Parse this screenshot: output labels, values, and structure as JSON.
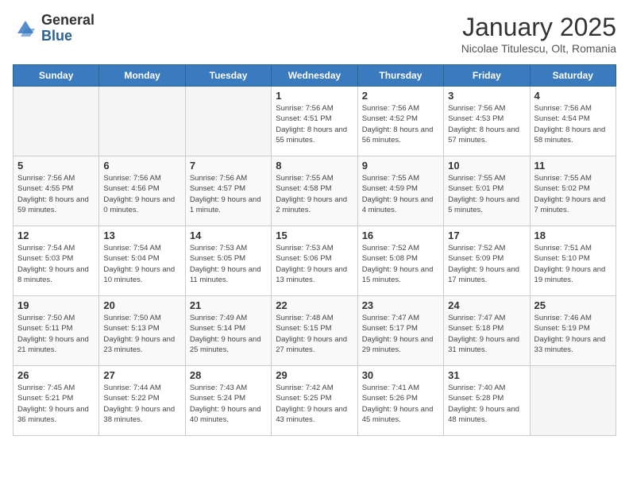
{
  "header": {
    "logo_general": "General",
    "logo_blue": "Blue",
    "title": "January 2025",
    "subtitle": "Nicolae Titulescu, Olt, Romania"
  },
  "days_of_week": [
    "Sunday",
    "Monday",
    "Tuesday",
    "Wednesday",
    "Thursday",
    "Friday",
    "Saturday"
  ],
  "weeks": [
    [
      {
        "day": "",
        "empty": true
      },
      {
        "day": "",
        "empty": true
      },
      {
        "day": "",
        "empty": true
      },
      {
        "day": "1",
        "sunrise": "Sunrise: 7:56 AM",
        "sunset": "Sunset: 4:51 PM",
        "daylight": "Daylight: 8 hours and 55 minutes."
      },
      {
        "day": "2",
        "sunrise": "Sunrise: 7:56 AM",
        "sunset": "Sunset: 4:52 PM",
        "daylight": "Daylight: 8 hours and 56 minutes."
      },
      {
        "day": "3",
        "sunrise": "Sunrise: 7:56 AM",
        "sunset": "Sunset: 4:53 PM",
        "daylight": "Daylight: 8 hours and 57 minutes."
      },
      {
        "day": "4",
        "sunrise": "Sunrise: 7:56 AM",
        "sunset": "Sunset: 4:54 PM",
        "daylight": "Daylight: 8 hours and 58 minutes."
      }
    ],
    [
      {
        "day": "5",
        "sunrise": "Sunrise: 7:56 AM",
        "sunset": "Sunset: 4:55 PM",
        "daylight": "Daylight: 8 hours and 59 minutes."
      },
      {
        "day": "6",
        "sunrise": "Sunrise: 7:56 AM",
        "sunset": "Sunset: 4:56 PM",
        "daylight": "Daylight: 9 hours and 0 minutes."
      },
      {
        "day": "7",
        "sunrise": "Sunrise: 7:56 AM",
        "sunset": "Sunset: 4:57 PM",
        "daylight": "Daylight: 9 hours and 1 minute."
      },
      {
        "day": "8",
        "sunrise": "Sunrise: 7:55 AM",
        "sunset": "Sunset: 4:58 PM",
        "daylight": "Daylight: 9 hours and 2 minutes."
      },
      {
        "day": "9",
        "sunrise": "Sunrise: 7:55 AM",
        "sunset": "Sunset: 4:59 PM",
        "daylight": "Daylight: 9 hours and 4 minutes."
      },
      {
        "day": "10",
        "sunrise": "Sunrise: 7:55 AM",
        "sunset": "Sunset: 5:01 PM",
        "daylight": "Daylight: 9 hours and 5 minutes."
      },
      {
        "day": "11",
        "sunrise": "Sunrise: 7:55 AM",
        "sunset": "Sunset: 5:02 PM",
        "daylight": "Daylight: 9 hours and 7 minutes."
      }
    ],
    [
      {
        "day": "12",
        "sunrise": "Sunrise: 7:54 AM",
        "sunset": "Sunset: 5:03 PM",
        "daylight": "Daylight: 9 hours and 8 minutes."
      },
      {
        "day": "13",
        "sunrise": "Sunrise: 7:54 AM",
        "sunset": "Sunset: 5:04 PM",
        "daylight": "Daylight: 9 hours and 10 minutes."
      },
      {
        "day": "14",
        "sunrise": "Sunrise: 7:53 AM",
        "sunset": "Sunset: 5:05 PM",
        "daylight": "Daylight: 9 hours and 11 minutes."
      },
      {
        "day": "15",
        "sunrise": "Sunrise: 7:53 AM",
        "sunset": "Sunset: 5:06 PM",
        "daylight": "Daylight: 9 hours and 13 minutes."
      },
      {
        "day": "16",
        "sunrise": "Sunrise: 7:52 AM",
        "sunset": "Sunset: 5:08 PM",
        "daylight": "Daylight: 9 hours and 15 minutes."
      },
      {
        "day": "17",
        "sunrise": "Sunrise: 7:52 AM",
        "sunset": "Sunset: 5:09 PM",
        "daylight": "Daylight: 9 hours and 17 minutes."
      },
      {
        "day": "18",
        "sunrise": "Sunrise: 7:51 AM",
        "sunset": "Sunset: 5:10 PM",
        "daylight": "Daylight: 9 hours and 19 minutes."
      }
    ],
    [
      {
        "day": "19",
        "sunrise": "Sunrise: 7:50 AM",
        "sunset": "Sunset: 5:11 PM",
        "daylight": "Daylight: 9 hours and 21 minutes."
      },
      {
        "day": "20",
        "sunrise": "Sunrise: 7:50 AM",
        "sunset": "Sunset: 5:13 PM",
        "daylight": "Daylight: 9 hours and 23 minutes."
      },
      {
        "day": "21",
        "sunrise": "Sunrise: 7:49 AM",
        "sunset": "Sunset: 5:14 PM",
        "daylight": "Daylight: 9 hours and 25 minutes."
      },
      {
        "day": "22",
        "sunrise": "Sunrise: 7:48 AM",
        "sunset": "Sunset: 5:15 PM",
        "daylight": "Daylight: 9 hours and 27 minutes."
      },
      {
        "day": "23",
        "sunrise": "Sunrise: 7:47 AM",
        "sunset": "Sunset: 5:17 PM",
        "daylight": "Daylight: 9 hours and 29 minutes."
      },
      {
        "day": "24",
        "sunrise": "Sunrise: 7:47 AM",
        "sunset": "Sunset: 5:18 PM",
        "daylight": "Daylight: 9 hours and 31 minutes."
      },
      {
        "day": "25",
        "sunrise": "Sunrise: 7:46 AM",
        "sunset": "Sunset: 5:19 PM",
        "daylight": "Daylight: 9 hours and 33 minutes."
      }
    ],
    [
      {
        "day": "26",
        "sunrise": "Sunrise: 7:45 AM",
        "sunset": "Sunset: 5:21 PM",
        "daylight": "Daylight: 9 hours and 36 minutes."
      },
      {
        "day": "27",
        "sunrise": "Sunrise: 7:44 AM",
        "sunset": "Sunset: 5:22 PM",
        "daylight": "Daylight: 9 hours and 38 minutes."
      },
      {
        "day": "28",
        "sunrise": "Sunrise: 7:43 AM",
        "sunset": "Sunset: 5:24 PM",
        "daylight": "Daylight: 9 hours and 40 minutes."
      },
      {
        "day": "29",
        "sunrise": "Sunrise: 7:42 AM",
        "sunset": "Sunset: 5:25 PM",
        "daylight": "Daylight: 9 hours and 43 minutes."
      },
      {
        "day": "30",
        "sunrise": "Sunrise: 7:41 AM",
        "sunset": "Sunset: 5:26 PM",
        "daylight": "Daylight: 9 hours and 45 minutes."
      },
      {
        "day": "31",
        "sunrise": "Sunrise: 7:40 AM",
        "sunset": "Sunset: 5:28 PM",
        "daylight": "Daylight: 9 hours and 48 minutes."
      },
      {
        "day": "",
        "empty": true
      }
    ]
  ]
}
